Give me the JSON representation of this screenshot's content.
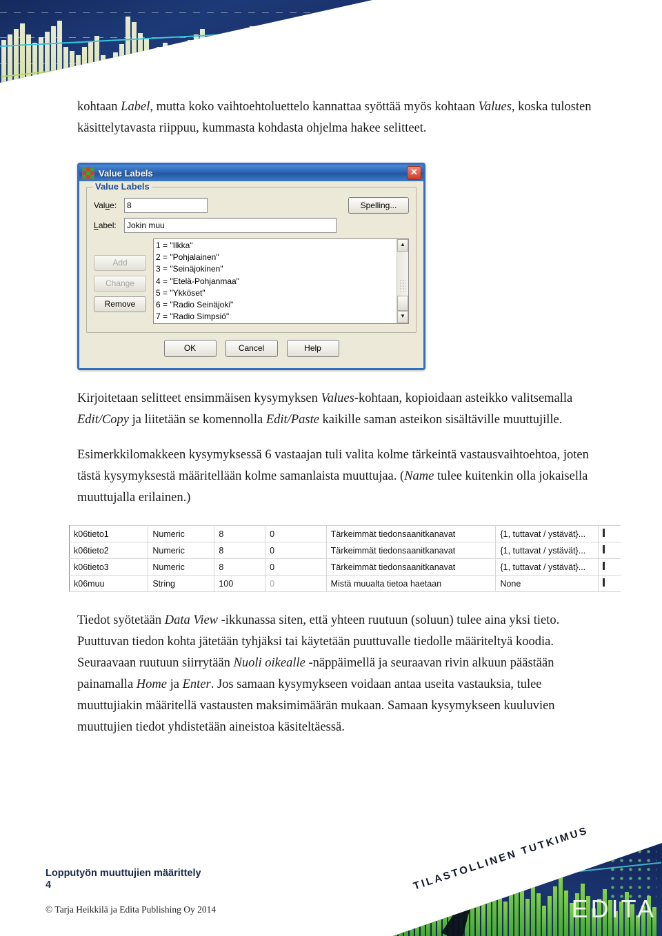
{
  "header_graphic": {
    "alt": "statistics-bar-chart-banner"
  },
  "intro_paragraph": {
    "line1_a": "kohtaan ",
    "line1_em": "Label",
    "line1_b": ", mutta koko vaihtoehtoluettelo kannattaa syöttää myös kohtaan ",
    "line1_em2": "Values",
    "line1_c": ", koska tulosten käsittelytavasta riippuu, kummasta kohdasta ohjelma hakee selitteet."
  },
  "dialog": {
    "title": "Value Labels",
    "close_label": "✕",
    "groupbox_legend": "Value Labels",
    "value_field": {
      "label": "Value:",
      "value": "8"
    },
    "label_field": {
      "label": "Label:",
      "value": "Jokin muu"
    },
    "spelling_button": "Spelling...",
    "side_buttons": [
      {
        "label": "Add",
        "enabled": false
      },
      {
        "label": "Change",
        "enabled": false
      },
      {
        "label": "Remove",
        "enabled": true
      }
    ],
    "list_items": [
      "1 = \"Ilkka\"",
      "2 = \"Pohjalainen\"",
      "3 = \"Seinäjokinen\"",
      "4 = \"Etelä-Pohjanmaa\"",
      "5 = \"Ykköset\"",
      "6 = \"Radio Seinäjoki\"",
      "7 = \"Radio Simpsiö\""
    ],
    "scroll_up": "▲",
    "scroll_down": "▼",
    "footer_buttons": [
      "OK",
      "Cancel",
      "Help"
    ]
  },
  "para_2": {
    "a": "Kirjoitetaan selitteet ensimmäisen kysymyksen ",
    "em1": "Values",
    "b": "-kohtaan, kopioidaan asteikko valitsemalla ",
    "em2": "Edit/Copy",
    "c": " ja liitetään se komennolla ",
    "em3": "Edit/Paste",
    "d": " kaikille saman asteikon sisältäville muuttujille."
  },
  "para_3": {
    "a": "Esimerkkilomakkeen kysymyksessä 6 vastaajan tuli valita kolme tärkeintä vastausvaihtoehtoa, joten tästä kysymyksestä määritellään kolme samanlaista muuttujaa. (",
    "em1": "Name",
    "b": " tulee kuitenkin olla jokaisella muuttujalla erilainen.)"
  },
  "variable_table": {
    "rows": [
      {
        "name": "k06tieto1",
        "type": "Numeric",
        "width": "8",
        "decimals": "0",
        "label": "Tärkeimmät tiedonsaanitkanavat",
        "values": "{1, tuttavat / ystävät}...",
        "dim_decimals": false
      },
      {
        "name": "k06tieto2",
        "type": "Numeric",
        "width": "8",
        "decimals": "0",
        "label": "Tärkeimmät tiedonsaanitkanavat",
        "values": "{1, tuttavat / ystävät}...",
        "dim_decimals": false
      },
      {
        "name": "k06tieto3",
        "type": "Numeric",
        "width": "8",
        "decimals": "0",
        "label": "Tärkeimmät tiedonsaanitkanavat",
        "values": "{1, tuttavat / ystävät}...",
        "dim_decimals": false
      },
      {
        "name": "k06muu",
        "type": "String",
        "width": "100",
        "decimals": "0",
        "label": "Mistä muualta tietoa haetaan",
        "values": "None",
        "dim_decimals": true
      }
    ]
  },
  "para_4": {
    "a": "Tiedot syötetään ",
    "em1": "Data View",
    "b": " -ikkunassa siten, että yhteen ruutuun (soluun) tulee aina yksi tieto. Puuttuvan tiedon kohta jätetään tyhjäksi tai käytetään puuttuvalle tiedolle määriteltyä koodia. Seuraavaan ruutuun siirrytään ",
    "em2": "Nuoli oikealle",
    "c": " -näppäimellä ja seuraavan rivin alkuun päästään painamalla ",
    "em3": "Home",
    "d": " ja ",
    "em4": "Enter",
    "e": ". Jos samaan kysymykseen voidaan antaa useita vastauksia, tulee muuttujiakin määritellä vastausten maksimimäärän mukaan. Samaan kysymykseen kuuluvien muuttujien tiedot yhdistetään aineistoa käsiteltäessä."
  },
  "footer": {
    "title": "Lopputyön muuttujien määrittely",
    "page_number": "4",
    "copyright": "© Tarja Heikkilä ja Edita Publishing Oy 2014",
    "banner_text": "TILASTOLLINEN TUTKIMUS",
    "brand": "EDITA"
  },
  "colors": {
    "dialog_border": "#2f6fbf",
    "dialog_face": "#ece9d8",
    "title_gradient_start": "#4a8ad4",
    "groupbox_legend": "#1f4e9c",
    "footer_title": "#1b2a4a",
    "deco_dark_blue": "#13255a",
    "deco_green": "#86d24a",
    "deco_cyan": "#4fd2e6"
  }
}
